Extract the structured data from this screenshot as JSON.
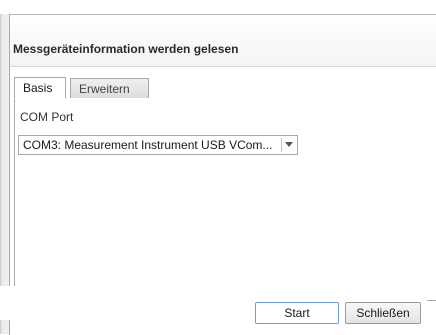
{
  "dialog": {
    "title": "Messgeräteinformation werden gelesen"
  },
  "tabs": [
    {
      "label": "Basis",
      "active": true
    },
    {
      "label": "Erweitern",
      "active": false
    }
  ],
  "basis": {
    "com_port_label": "COM Port",
    "com_port_value": "COM3: Measurement Instrument USB VCom..."
  },
  "footer": {
    "start_label": "Start",
    "close_label": "Schließen"
  }
}
